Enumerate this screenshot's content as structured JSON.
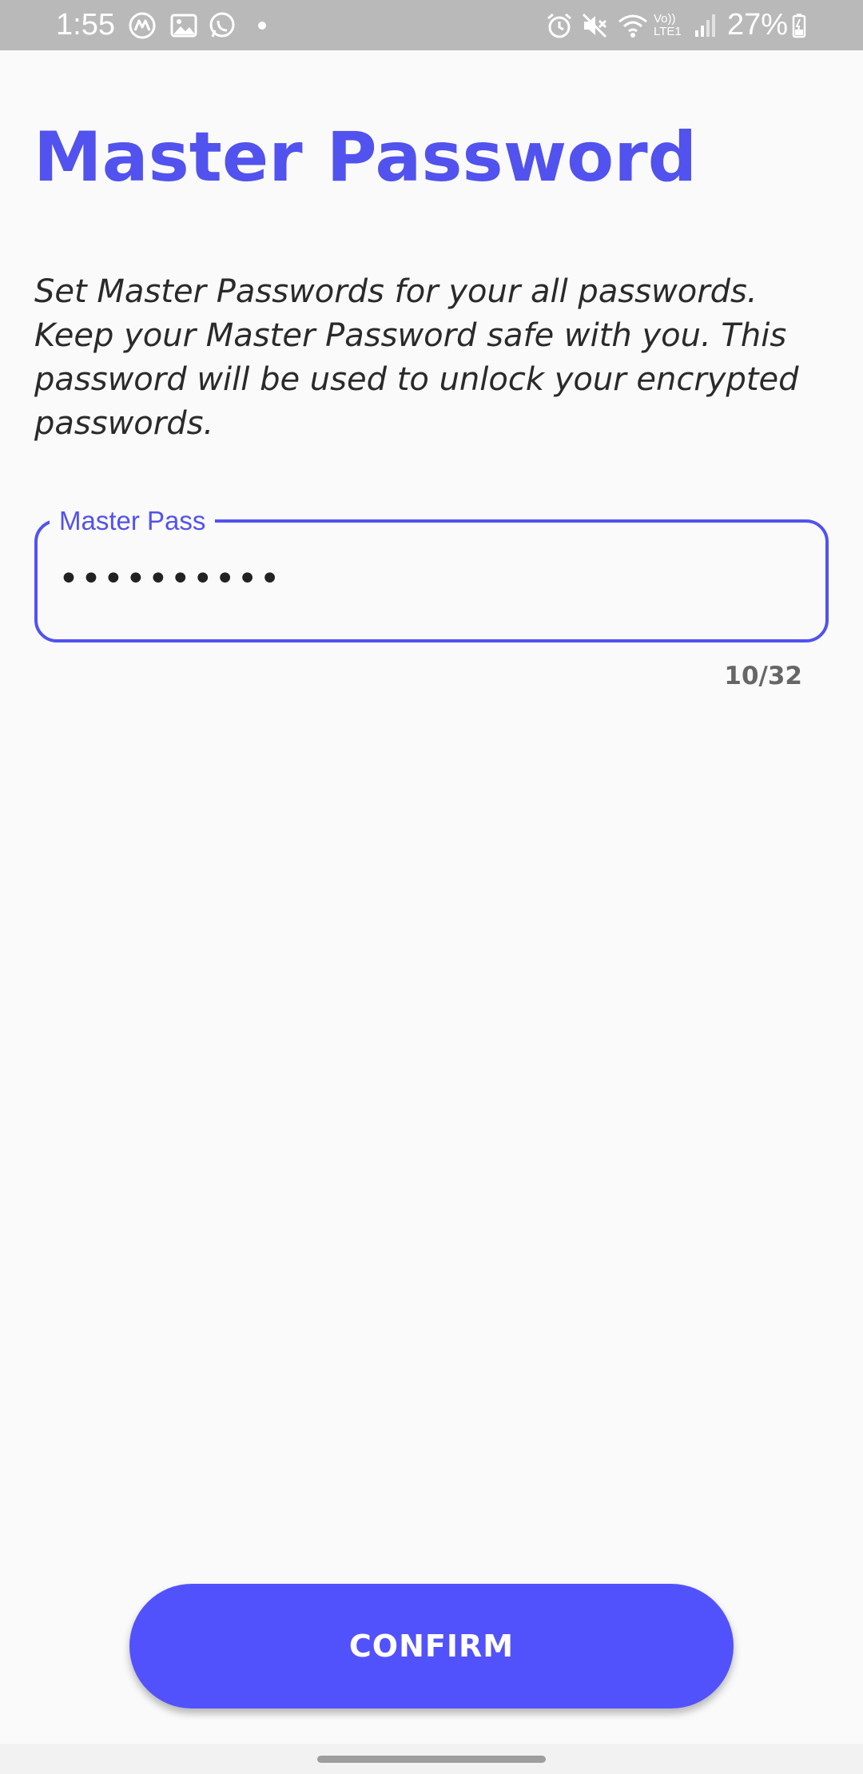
{
  "status_bar": {
    "time": "1:55",
    "battery": "27%",
    "network_label": "Vo)) LTE1",
    "notification_icons": [
      "cm-icon",
      "gallery-icon",
      "whatsapp-icon",
      "dot-icon"
    ],
    "system_icons": [
      "alarm-icon",
      "mute-icon",
      "wifi-icon",
      "lte-icon",
      "signal-icon",
      "battery-icon"
    ]
  },
  "header": {
    "title": "Master Password"
  },
  "main": {
    "description": "Set Master Passwords for your all passwords. Keep your Master Password safe with you. This password will be used to unlock your encrypted passwords.",
    "field": {
      "label": "Master Pass",
      "value": "••••••••••",
      "counter": "10/32"
    }
  },
  "actions": {
    "confirm_label": "CONFIRM"
  },
  "colors": {
    "accent": "#5252ee",
    "button": "#5252fc",
    "status_bar": "#b9b9b9",
    "background": "#fafafa"
  }
}
